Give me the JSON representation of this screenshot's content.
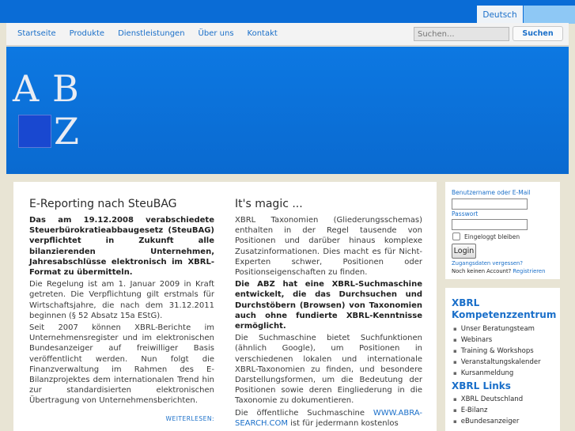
{
  "language": "Deutsch",
  "nav": [
    "Startseite",
    "Produkte",
    "Dienstleistungen",
    "Über uns",
    "Kontakt"
  ],
  "search": {
    "placeholder": "Suchen...",
    "button": "Suchen"
  },
  "logo": {
    "a": "A",
    "b": "B",
    "z": "Z"
  },
  "article1": {
    "title": "E-Reporting nach SteuBAG",
    "lead": "Das am 19.12.2008 verabschiedete Steuerbürokratieabbaugesetz (SteuBAG) verpflichtet in Zukunft alle bilanzierenden Unternehmen, Jahresabschlüsse elektronisch im XBRL-Format zu übermitteln.",
    "p1": "Die Regelung ist am 1. Januar 2009 in Kraft getreten. Die Verpflichtung gilt erstmals für Wirtschaftsjahre, die nach dem 31.12.2011 beginnen (§ 52 Absatz 15a EStG).",
    "p2": "Seit 2007 können XBRL-Berichte im Unternehmensregister und im elektronischen Bundesanzeiger auf freiwilliger Basis veröffentlicht werden. Nun folgt die Finanzverwaltung im Rahmen des E-Bilanzprojektes dem internationalen Trend hin zur standardisierten elektronischen Übertragung von Unternehmensberichten.",
    "readmore": "WEITERLESEN:"
  },
  "article2": {
    "title": "It's magic ...",
    "p1": "XBRL Taxonomien (Gliederungsschemas) enthalten in der Regel tausende von Positionen und darüber hinaus komplexe Zusatzinformationen. Dies macht es für Nicht-Experten schwer, Positionen oder Positionseigenschaften zu finden.",
    "lead": "Die ABZ hat eine XBRL-Suchmaschine entwickelt, die das Durchsuchen und Durchstöbern (Browsen) von Taxonomien auch ohne fundierte XBRL-Kenntnisse ermöglicht.",
    "p2": "Die Suchmaschine bietet Suchfunktionen (ähnlich Google), um Positionen in verschiedenen lokalen und internationale XBRL-Taxonomien zu finden, und besondere Darstellungsformen, um die Bedeutung der Positionen sowie deren Eingliederung in die Taxonomie zu dokumentieren.",
    "p3_pre": "Die öffentliche Suchmaschine",
    "p3_link": "WWW.ABRA-SEARCH.COM",
    "p3_post": "ist für jedermann kostenlos"
  },
  "login": {
    "user_label": "Benutzername oder E-Mail",
    "password_label": "Passwort",
    "remember": "Eingeloggt bleiben",
    "button": "Login",
    "forgot": "Zugangsdaten vergessen?",
    "no_account": "Noch keinen Account?",
    "register": "Registrieren"
  },
  "sidebar": {
    "heading1_line1": "XBRL",
    "heading1_line2": "Kompetenzzentrum",
    "items1": [
      "Unser Beratungsteam",
      "Webinars",
      "Training & Workshops",
      "Veranstaltungskalender",
      "Kursanmeldung"
    ],
    "heading2": "XBRL Links",
    "items2": [
      "XBRL Deutschland",
      "E-Bilanz",
      "eBundesanzeiger"
    ]
  }
}
